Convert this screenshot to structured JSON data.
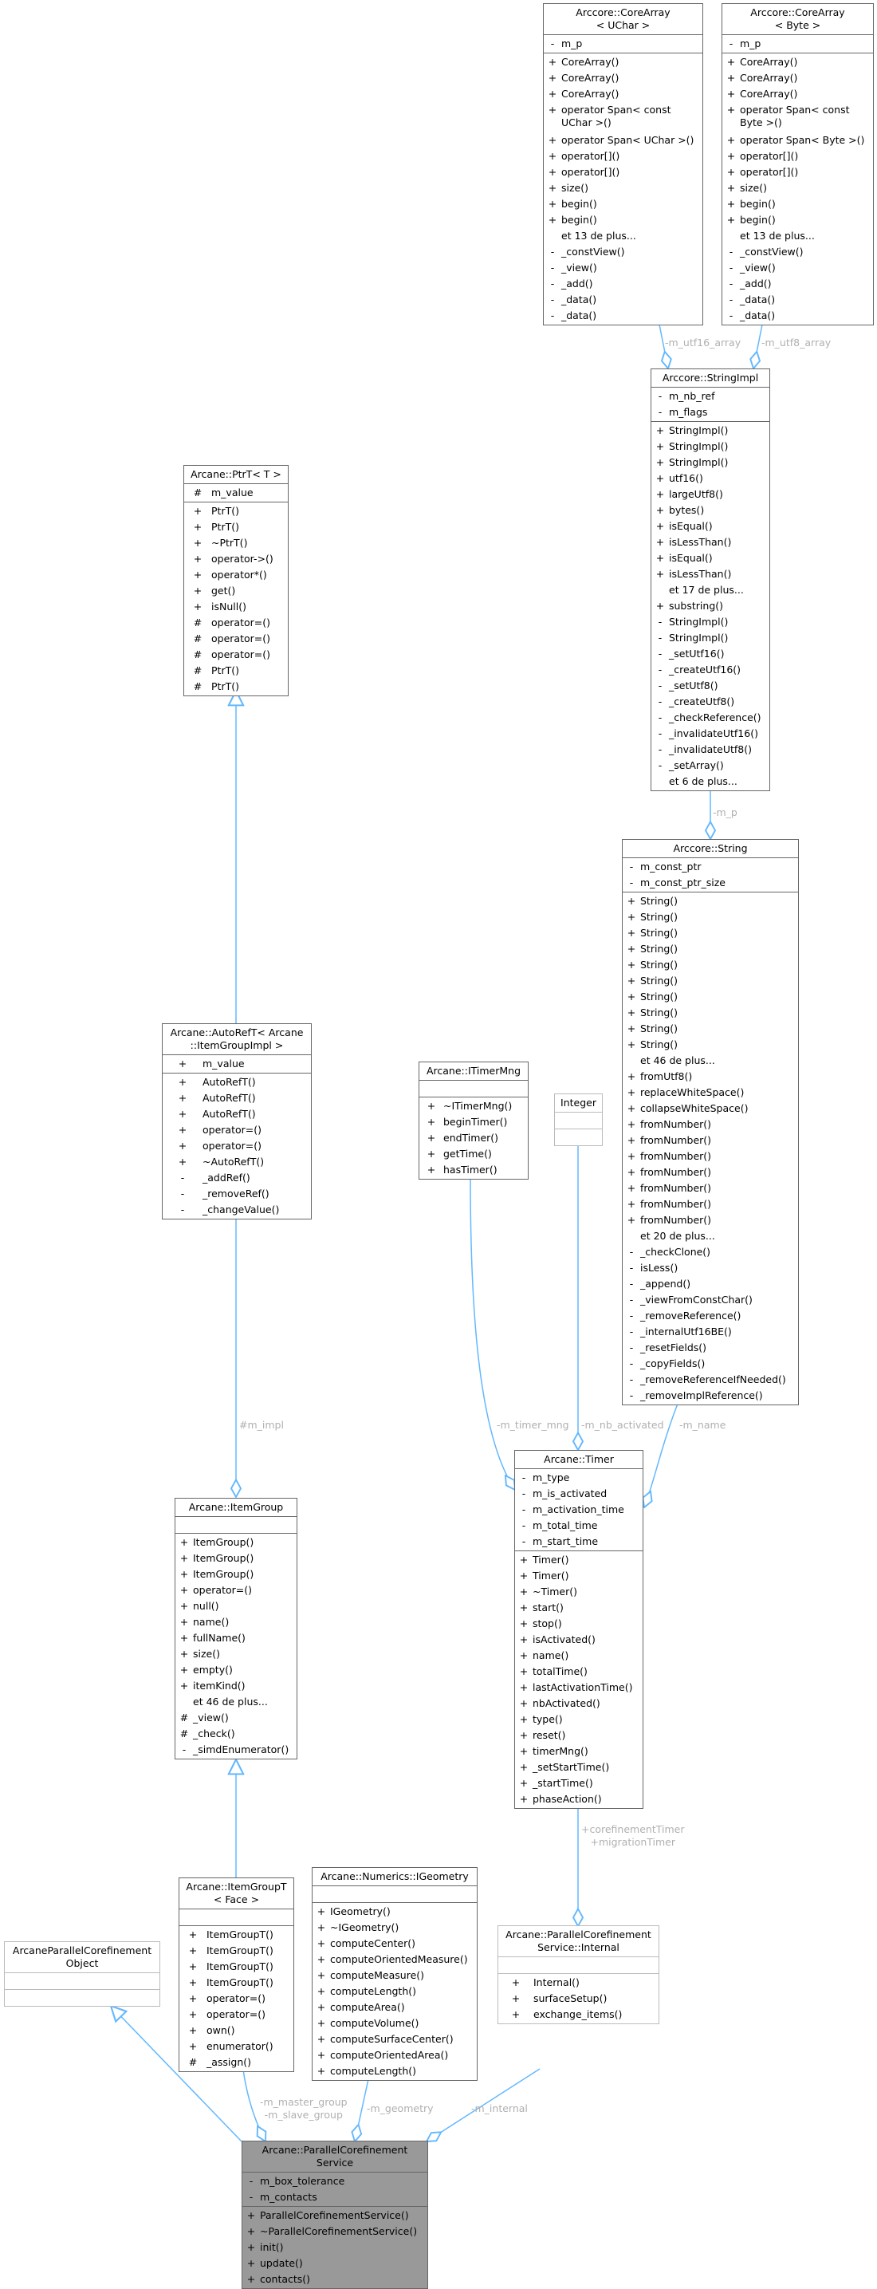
{
  "classes": [
    {
      "id": "corearray_uchar",
      "title": "Arccore::CoreArray\n< UChar >",
      "style": "normal",
      "vis_w": 22,
      "attrs": [
        {
          "v": "-",
          "n": "m_p"
        }
      ],
      "methods": [
        {
          "v": "+",
          "n": "CoreArray()"
        },
        {
          "v": "+",
          "n": "CoreArray()"
        },
        {
          "v": "+",
          "n": "CoreArray()"
        },
        {
          "v": "+",
          "n": "operator Span< const\n UChar >()",
          "wrap": true
        },
        {
          "v": "+",
          "n": "operator Span< UChar >()"
        },
        {
          "v": "+",
          "n": "operator[]()"
        },
        {
          "v": "+",
          "n": "operator[]()"
        },
        {
          "v": "+",
          "n": "size()"
        },
        {
          "v": "+",
          "n": "begin()"
        },
        {
          "v": "+",
          "n": "begin()"
        },
        {
          "v": "",
          "n": "et 13 de plus..."
        },
        {
          "v": "-",
          "n": "_constView()"
        },
        {
          "v": "-",
          "n": "_view()"
        },
        {
          "v": "-",
          "n": "_add()"
        },
        {
          "v": "-",
          "n": "_data()"
        },
        {
          "v": "-",
          "n": "_data()"
        }
      ]
    },
    {
      "id": "corearray_byte",
      "title": "Arccore::CoreArray\n< Byte >",
      "style": "normal",
      "vis_w": 22,
      "attrs": [
        {
          "v": "-",
          "n": "m_p"
        }
      ],
      "methods": [
        {
          "v": "+",
          "n": "CoreArray()"
        },
        {
          "v": "+",
          "n": "CoreArray()"
        },
        {
          "v": "+",
          "n": "CoreArray()"
        },
        {
          "v": "+",
          "n": "operator Span< const\n Byte >()",
          "wrap": true
        },
        {
          "v": "+",
          "n": "operator Span< Byte >()"
        },
        {
          "v": "+",
          "n": "operator[]()"
        },
        {
          "v": "+",
          "n": "operator[]()"
        },
        {
          "v": "+",
          "n": "size()"
        },
        {
          "v": "+",
          "n": "begin()"
        },
        {
          "v": "+",
          "n": "begin()"
        },
        {
          "v": "",
          "n": "et 13 de plus..."
        },
        {
          "v": "-",
          "n": "_constView()"
        },
        {
          "v": "-",
          "n": "_view()"
        },
        {
          "v": "-",
          "n": "_add()"
        },
        {
          "v": "-",
          "n": "_data()"
        },
        {
          "v": "-",
          "n": "_data()"
        }
      ]
    },
    {
      "id": "stringimpl",
      "title": "Arccore::StringImpl",
      "style": "normal",
      "vis_w": 22,
      "attrs": [
        {
          "v": "-",
          "n": "m_nb_ref"
        },
        {
          "v": "-",
          "n": "m_flags"
        }
      ],
      "methods": [
        {
          "v": "+",
          "n": "StringImpl()"
        },
        {
          "v": "+",
          "n": "StringImpl()"
        },
        {
          "v": "+",
          "n": "StringImpl()"
        },
        {
          "v": "+",
          "n": "utf16()"
        },
        {
          "v": "+",
          "n": "largeUtf8()"
        },
        {
          "v": "+",
          "n": "bytes()"
        },
        {
          "v": "+",
          "n": "isEqual()"
        },
        {
          "v": "+",
          "n": "isLessThan()"
        },
        {
          "v": "+",
          "n": "isEqual()"
        },
        {
          "v": "+",
          "n": "isLessThan()"
        },
        {
          "v": "",
          "n": "et 17 de plus..."
        },
        {
          "v": "+",
          "n": "substring()"
        },
        {
          "v": "-",
          "n": "StringImpl()"
        },
        {
          "v": "-",
          "n": "StringImpl()"
        },
        {
          "v": "-",
          "n": "_setUtf16()"
        },
        {
          "v": "-",
          "n": "_createUtf16()"
        },
        {
          "v": "-",
          "n": "_setUtf8()"
        },
        {
          "v": "-",
          "n": "_createUtf8()"
        },
        {
          "v": "-",
          "n": "_checkReference()"
        },
        {
          "v": "-",
          "n": "_invalidateUtf16()"
        },
        {
          "v": "-",
          "n": "_invalidateUtf8()"
        },
        {
          "v": "-",
          "n": "_setArray()"
        },
        {
          "v": "",
          "n": "et 6 de plus..."
        }
      ]
    },
    {
      "id": "string",
      "title": "Arccore::String",
      "style": "normal",
      "vis_w": 22,
      "attrs": [
        {
          "v": "-",
          "n": "m_const_ptr"
        },
        {
          "v": "-",
          "n": "m_const_ptr_size"
        }
      ],
      "methods": [
        {
          "v": "+",
          "n": "String()"
        },
        {
          "v": "+",
          "n": "String()"
        },
        {
          "v": "+",
          "n": "String()"
        },
        {
          "v": "+",
          "n": "String()"
        },
        {
          "v": "+",
          "n": "String()"
        },
        {
          "v": "+",
          "n": "String()"
        },
        {
          "v": "+",
          "n": "String()"
        },
        {
          "v": "+",
          "n": "String()"
        },
        {
          "v": "+",
          "n": "String()"
        },
        {
          "v": "+",
          "n": "String()"
        },
        {
          "v": "",
          "n": "et 46 de plus..."
        },
        {
          "v": "+",
          "n": "fromUtf8()"
        },
        {
          "v": "+",
          "n": "replaceWhiteSpace()"
        },
        {
          "v": "+",
          "n": "collapseWhiteSpace()"
        },
        {
          "v": "+",
          "n": "fromNumber()"
        },
        {
          "v": "+",
          "n": "fromNumber()"
        },
        {
          "v": "+",
          "n": "fromNumber()"
        },
        {
          "v": "+",
          "n": "fromNumber()"
        },
        {
          "v": "+",
          "n": "fromNumber()"
        },
        {
          "v": "+",
          "n": "fromNumber()"
        },
        {
          "v": "+",
          "n": "fromNumber()"
        },
        {
          "v": "",
          "n": "et 20 de plus..."
        },
        {
          "v": "-",
          "n": "_checkClone()"
        },
        {
          "v": "-",
          "n": "isLess()"
        },
        {
          "v": "-",
          "n": "_append()"
        },
        {
          "v": "-",
          "n": "_viewFromConstChar()"
        },
        {
          "v": "-",
          "n": "_removeReference()"
        },
        {
          "v": "-",
          "n": "_internalUtf16BE()"
        },
        {
          "v": "-",
          "n": "_resetFields()"
        },
        {
          "v": "-",
          "n": "_copyFields()"
        },
        {
          "v": "-",
          "n": "_removeReferenceIfNeeded()"
        },
        {
          "v": "-",
          "n": "_removeImplReference()"
        }
      ]
    },
    {
      "id": "ptrt",
      "title": "Arcane::PtrT< T >",
      "style": "normal",
      "vis_w": 34,
      "attrs": [
        {
          "v": "#",
          "n": "m_value"
        }
      ],
      "methods": [
        {
          "v": "+",
          "n": "PtrT()"
        },
        {
          "v": "+",
          "n": "PtrT()"
        },
        {
          "v": "+",
          "n": "~PtrT()"
        },
        {
          "v": "+",
          "n": "operator->()"
        },
        {
          "v": "+",
          "n": "operator*()"
        },
        {
          "v": "+",
          "n": "get()"
        },
        {
          "v": "+",
          "n": "isNull()"
        },
        {
          "v": "#",
          "n": "operator=()"
        },
        {
          "v": "#",
          "n": "operator=()"
        },
        {
          "v": "#",
          "n": "operator=()"
        },
        {
          "v": "#",
          "n": "PtrT()"
        },
        {
          "v": "#",
          "n": "PtrT()"
        }
      ]
    },
    {
      "id": "autoref",
      "title": "Arcane::AutoRefT< Arcane\n::ItemGroupImpl >",
      "style": "normal",
      "vis_w": 50,
      "attrs": [
        {
          "v": "+",
          "n": "m_value"
        }
      ],
      "methods": [
        {
          "v": "+",
          "n": "AutoRefT()"
        },
        {
          "v": "+",
          "n": "AutoRefT()"
        },
        {
          "v": "+",
          "n": "AutoRefT()"
        },
        {
          "v": "+",
          "n": "operator=()"
        },
        {
          "v": "+",
          "n": "operator=()"
        },
        {
          "v": "+",
          "n": "~AutoRefT()"
        },
        {
          "v": "-",
          "n": "_addRef()"
        },
        {
          "v": "-",
          "n": "_removeRef()"
        },
        {
          "v": "-",
          "n": "_changeValue()"
        }
      ]
    },
    {
      "id": "itimermng",
      "title": "Arcane::ITimerMng",
      "style": "normal",
      "vis_w": 30,
      "attrs": [],
      "methods": [
        {
          "v": "+",
          "n": "~ITimerMng()"
        },
        {
          "v": "+",
          "n": "beginTimer()"
        },
        {
          "v": "+",
          "n": "endTimer()"
        },
        {
          "v": "+",
          "n": "getTime()"
        },
        {
          "v": "+",
          "n": "hasTimer()"
        }
      ]
    },
    {
      "id": "integer",
      "title": "Integer",
      "style": "light",
      "vis_w": 0,
      "attrs": [],
      "methods": []
    },
    {
      "id": "itemgroup",
      "title": "Arcane::ItemGroup",
      "style": "normal",
      "vis_w": 22,
      "attrs": [],
      "methods": [
        {
          "v": "+",
          "n": "ItemGroup()"
        },
        {
          "v": "+",
          "n": "ItemGroup()"
        },
        {
          "v": "+",
          "n": "ItemGroup()"
        },
        {
          "v": "+",
          "n": "operator=()"
        },
        {
          "v": "+",
          "n": "null()"
        },
        {
          "v": "+",
          "n": "name()"
        },
        {
          "v": "+",
          "n": "fullName()"
        },
        {
          "v": "+",
          "n": "size()"
        },
        {
          "v": "+",
          "n": "empty()"
        },
        {
          "v": "+",
          "n": "itemKind()"
        },
        {
          "v": "",
          "n": "et 46 de plus..."
        },
        {
          "v": "#",
          "n": "_view()"
        },
        {
          "v": "#",
          "n": "_check()"
        },
        {
          "v": "-",
          "n": "_simdEnumerator()"
        }
      ]
    },
    {
      "id": "timer",
      "title": "Arcane::Timer",
      "style": "normal",
      "vis_w": 22,
      "attrs": [
        {
          "v": "-",
          "n": "m_type"
        },
        {
          "v": "-",
          "n": "m_is_activated"
        },
        {
          "v": "-",
          "n": "m_activation_time"
        },
        {
          "v": "-",
          "n": "m_total_time"
        },
        {
          "v": "-",
          "n": "m_start_time"
        }
      ],
      "methods": [
        {
          "v": "+",
          "n": "Timer()"
        },
        {
          "v": "+",
          "n": "Timer()"
        },
        {
          "v": "+",
          "n": "~Timer()"
        },
        {
          "v": "+",
          "n": "start()"
        },
        {
          "v": "+",
          "n": "stop()"
        },
        {
          "v": "+",
          "n": "isActivated()"
        },
        {
          "v": "+",
          "n": "name()"
        },
        {
          "v": "+",
          "n": "totalTime()"
        },
        {
          "v": "+",
          "n": "lastActivationTime()"
        },
        {
          "v": "+",
          "n": "nbActivated()"
        },
        {
          "v": "+",
          "n": "type()"
        },
        {
          "v": "+",
          "n": "reset()"
        },
        {
          "v": "+",
          "n": "timerMng()"
        },
        {
          "v": "+",
          "n": "_setStartTime()"
        },
        {
          "v": "+",
          "n": "_startTime()"
        },
        {
          "v": "+",
          "n": "phaseAction()"
        }
      ]
    },
    {
      "id": "apco",
      "title": "ArcaneParallelCorefinement\nObject",
      "style": "light",
      "vis_w": 0,
      "attrs": [],
      "methods": []
    },
    {
      "id": "itemgroupt",
      "title": "Arcane::ItemGroupT\n< Face >",
      "style": "normal",
      "vis_w": 34,
      "attrs": [],
      "methods": [
        {
          "v": "+",
          "n": "ItemGroupT()"
        },
        {
          "v": "+",
          "n": "ItemGroupT()"
        },
        {
          "v": "+",
          "n": "ItemGroupT()"
        },
        {
          "v": "+",
          "n": "ItemGroupT()"
        },
        {
          "v": "+",
          "n": "operator=()"
        },
        {
          "v": "+",
          "n": "operator=()"
        },
        {
          "v": "+",
          "n": "own()"
        },
        {
          "v": "+",
          "n": "enumerator()"
        },
        {
          "v": "#",
          "n": "_assign()"
        }
      ]
    },
    {
      "id": "igeometry",
      "title": "Arcane::Numerics::IGeometry",
      "style": "normal",
      "vis_w": 22,
      "attrs": [],
      "methods": [
        {
          "v": "+",
          "n": "IGeometry()"
        },
        {
          "v": "+",
          "n": "~IGeometry()"
        },
        {
          "v": "+",
          "n": "computeCenter()"
        },
        {
          "v": "+",
          "n": "computeOrientedMeasure()"
        },
        {
          "v": "+",
          "n": "computeMeasure()"
        },
        {
          "v": "+",
          "n": "computeLength()"
        },
        {
          "v": "+",
          "n": "computeArea()"
        },
        {
          "v": "+",
          "n": "computeVolume()"
        },
        {
          "v": "+",
          "n": "computeSurfaceCenter()"
        },
        {
          "v": "+",
          "n": "computeOrientedArea()"
        },
        {
          "v": "+",
          "n": "computeLength()"
        }
      ]
    },
    {
      "id": "internal",
      "title": "Arcane::ParallelCorefinement\nService::Internal",
      "style": "light",
      "vis_w": 44,
      "attrs": [],
      "methods": [
        {
          "v": "+",
          "n": "Internal()"
        },
        {
          "v": "+",
          "n": "surfaceSetup()"
        },
        {
          "v": "+",
          "n": "exchange_items()"
        }
      ]
    },
    {
      "id": "pcs",
      "title": "Arcane::ParallelCorefinement\nService",
      "style": "focus",
      "vis_w": 22,
      "attrs": [
        {
          "v": "-",
          "n": "m_box_tolerance"
        },
        {
          "v": "-",
          "n": "m_contacts"
        }
      ],
      "methods": [
        {
          "v": "+",
          "n": "ParallelCorefinementService()"
        },
        {
          "v": "+",
          "n": "~ParallelCorefinementService()"
        },
        {
          "v": "+",
          "n": "init()"
        },
        {
          "v": "+",
          "n": "update()"
        },
        {
          "v": "+",
          "n": "contacts()"
        }
      ]
    }
  ],
  "edge_labels": {
    "m_utf16_array": "-m_utf16_array",
    "m_utf8_array": "-m_utf8_array",
    "m_p": "-m_p",
    "m_impl": "#m_impl",
    "m_timer_mng": "-m_timer_mng",
    "m_nb_activated": "-m_nb_activated",
    "m_name": "-m_name",
    "timers": "+corefinementTimer\n+migrationTimer",
    "groups": "-m_master_group\n-m_slave_group",
    "m_geometry": "-m_geometry",
    "m_internal": "-m_internal"
  },
  "colors": {
    "edge": "#63b8ff",
    "border": "#666666",
    "light_border": "#bbbbbb",
    "focus_fill": "#999999",
    "label": "#b0b0b0"
  }
}
